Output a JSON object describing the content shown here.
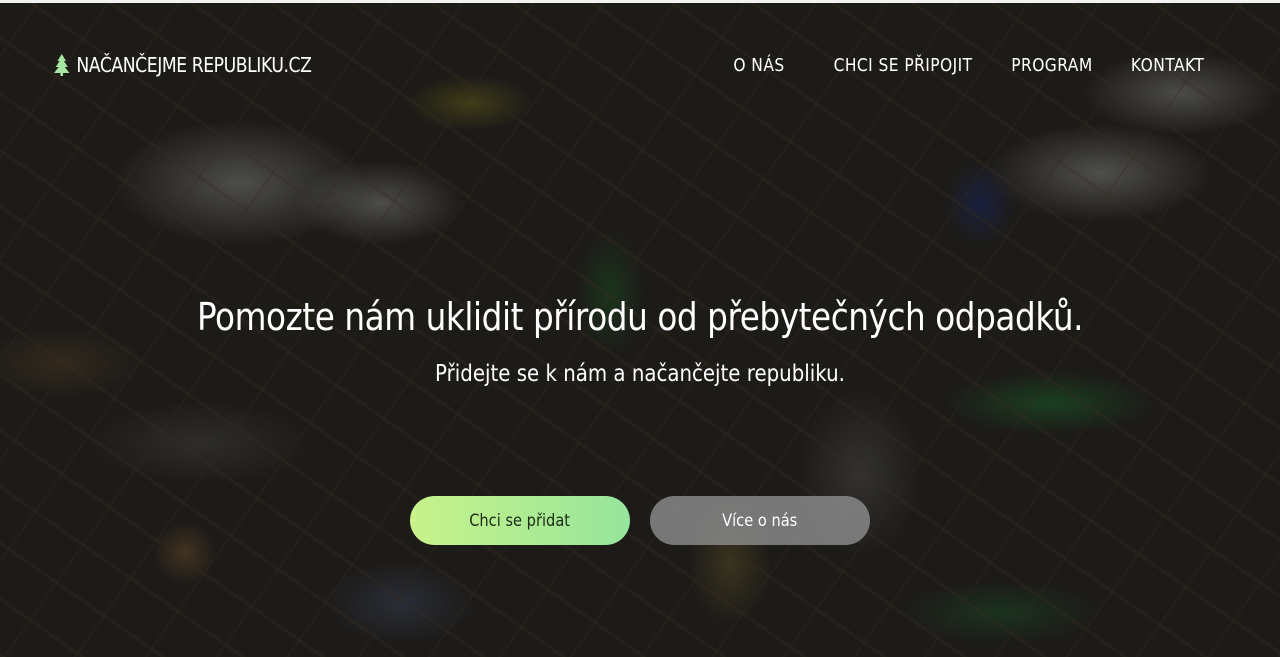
{
  "nav": {
    "brand": "NAČANČEJME REPUBLIKU.CZ",
    "brand_icon": "tree-icon",
    "items": [
      {
        "label": "O NÁS"
      },
      {
        "label": "CHCI SE PŘIPOJIT"
      },
      {
        "label": "PROGRAM"
      },
      {
        "label": "KONTAKT"
      }
    ]
  },
  "hero": {
    "headline": "Pomozte nám uklidit přírodu od přebytečných odpadků.",
    "subline": "Přidejte se k nám a načančejte republiku.",
    "primary_button": "Chci se přidat",
    "secondary_button": "Více o nás"
  },
  "colors": {
    "primary_button_start": "#c8f38a",
    "primary_button_end": "#96e59c",
    "brand_icon": "#a8e6a3"
  }
}
